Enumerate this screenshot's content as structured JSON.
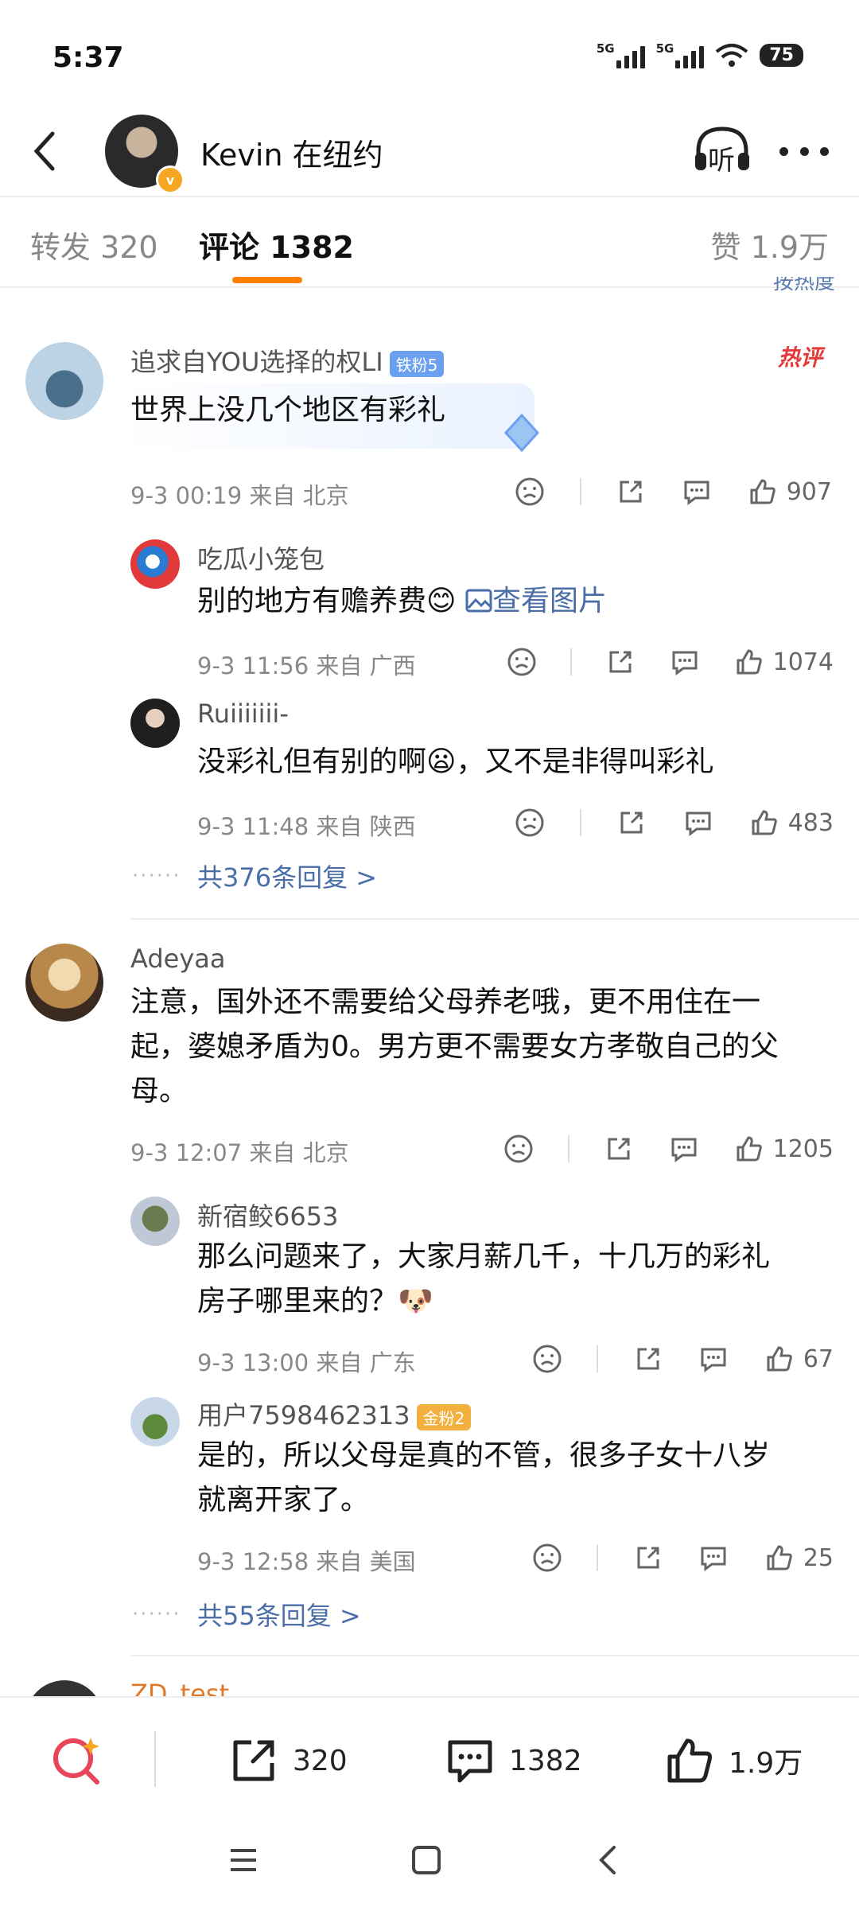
{
  "status_bar": {
    "time": "5:37",
    "signal1": "5G",
    "signal2": "5G",
    "battery": "75"
  },
  "header": {
    "title": "Kevin 在纽约",
    "verified_badge": "v",
    "listen_label": "听"
  },
  "tabs": {
    "repost": "转发 320",
    "comments": "评论 1382",
    "likes": "赞 1.9万"
  },
  "sort_stub": "按热度",
  "comments": [
    {
      "user": "追求自YOU选择的权LI",
      "badge": "铁粉5",
      "hot_tag": "热评",
      "text": "世界上没几个地区有彩礼",
      "time": "9-3 00:19 来自 北京",
      "likes": "907",
      "replies": [
        {
          "user": "吃瓜小笼包",
          "text": "别的地方有赡养费😊",
          "image_link": "查看图片",
          "time": "9-3 11:56 来自 广西",
          "likes": "1074"
        },
        {
          "user": "Ruiiiiiii-",
          "text": "没彩礼但有别的啊😦，又不是非得叫彩礼",
          "time": "9-3 11:48 来自 陕西",
          "likes": "483"
        }
      ],
      "more_replies": "共376条回复 >"
    },
    {
      "user": "Adeyaa",
      "text_line1": "注意，国外还不需要给父母养老哦，更不用住在一",
      "text_line2": "起，婆媳矛盾为0。男方更不需要女方孝敬自己的父",
      "text_line3": "母。",
      "time": "9-3 12:07 来自 北京",
      "likes": "1205",
      "replies": [
        {
          "user": "新宿鲛6653",
          "text_line1": "那么问题来了，大家月薪几千，十几万的彩礼",
          "text_line2": "房子哪里来的？🐶",
          "time": "9-3 13:00 来自 广东",
          "likes": "67"
        },
        {
          "user": "用户7598462313",
          "badge": "金粉2",
          "text_line1": "是的，所以父母是真的不管，很多子女十八岁",
          "text_line2": "就离开家了。",
          "time": "9-3 12:58 来自 美国",
          "likes": "25"
        }
      ],
      "more_replies": "共55条回复 >"
    },
    {
      "user": "ZD_test"
    }
  ],
  "bottom_bar": {
    "repost": "320",
    "comment": "1382",
    "like": "1.9万"
  },
  "colors": {
    "accent": "#ff8200",
    "link": "#4a6ea8",
    "hot": "#e43a3a"
  }
}
